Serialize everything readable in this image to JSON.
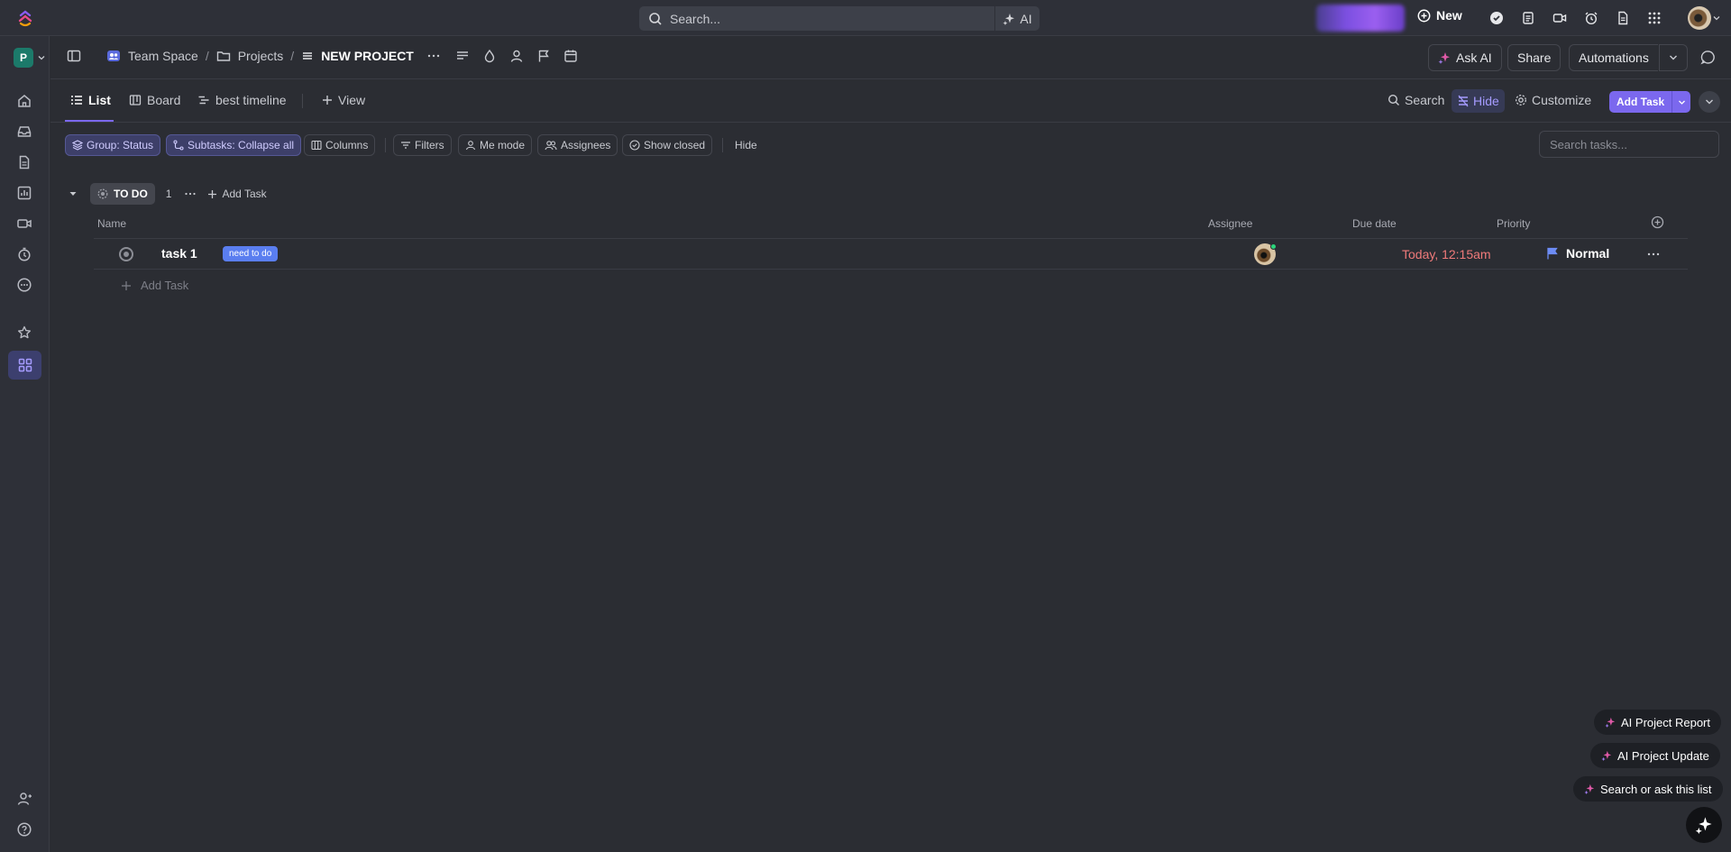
{
  "topbar": {
    "search_placeholder": "Search...",
    "ai_label": "AI",
    "new_label": "New"
  },
  "sidebar": {
    "workspace_letter": "P"
  },
  "breadcrumb": {
    "space": "Team Space",
    "folder": "Projects",
    "list": "NEW PROJECT",
    "sep": "/"
  },
  "header_actions": {
    "ask_ai": "Ask AI",
    "share": "Share",
    "automations": "Automations"
  },
  "views": {
    "tabs": [
      "List",
      "Board",
      "best timeline"
    ],
    "add_view": "View",
    "search": "Search",
    "hide": "Hide",
    "customize": "Customize",
    "add_task": "Add Task"
  },
  "filters": {
    "group": "Group: Status",
    "subtasks": "Subtasks: Collapse all",
    "columns": "Columns",
    "filters": "Filters",
    "me_mode": "Me mode",
    "assignees": "Assignees",
    "show_closed": "Show closed",
    "hide": "Hide",
    "search_placeholder": "Search tasks..."
  },
  "group": {
    "status": "TO DO",
    "count": "1",
    "add_task": "Add Task",
    "columns": {
      "name": "Name",
      "assignee": "Assignee",
      "due_date": "Due date",
      "priority": "Priority"
    }
  },
  "tasks": [
    {
      "name": "task 1",
      "tag": "need to do",
      "due": "Today, 12:15am",
      "priority": "Normal"
    }
  ],
  "add_task_row": "Add Task",
  "ai_actions": {
    "report": "AI Project Report",
    "update": "AI Project Update",
    "ask": "Search or ask this list"
  },
  "colors": {
    "accent": "#7b68ee",
    "tag": "#5a7ef0",
    "due_overdue": "#ef7a7a",
    "priority_flag": "#6d8cf5"
  }
}
